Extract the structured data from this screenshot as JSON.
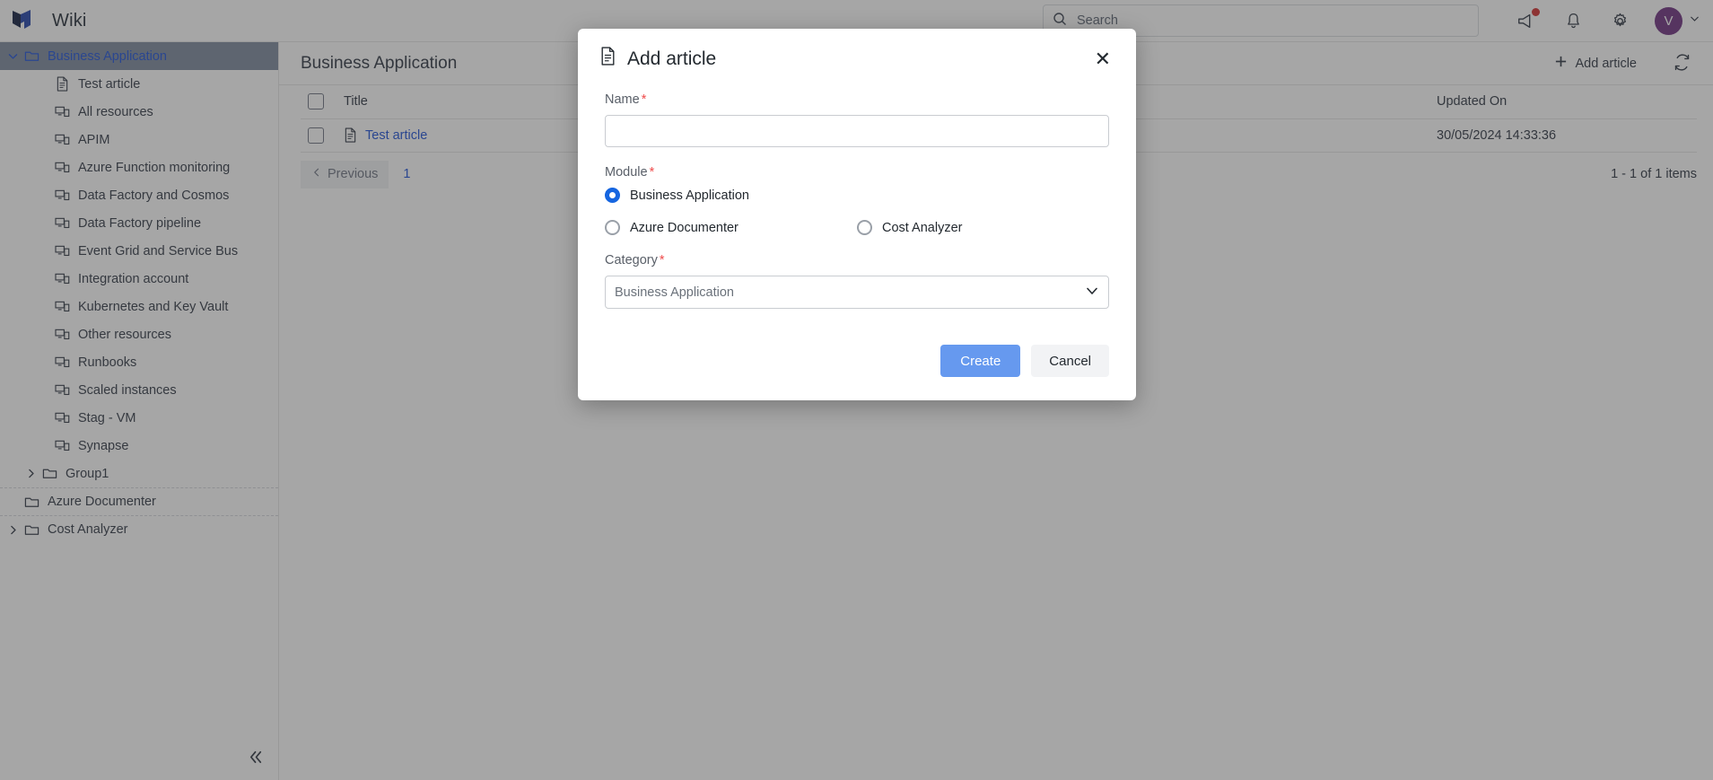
{
  "app": {
    "title": "Wiki",
    "logo_colors": {
      "dark": "#0d1b3e",
      "blue": "#1f3fa8"
    }
  },
  "header": {
    "search_placeholder": "Search",
    "search_value": "",
    "search_icon": "search-icon",
    "announcements_icon": "megaphone-icon",
    "announcements_badge_color": "#d12b2b",
    "notifications_icon": "bell-icon",
    "settings_icon": "gear-icon",
    "avatar_initial": "V",
    "avatar_color": "#6b2d7e",
    "avatar_caret_icon": "chevron-down-icon"
  },
  "sidebar": {
    "collapse_icon": "double-chevron-left-icon",
    "items": [
      {
        "label": "Business Application",
        "indent": 0,
        "icon": "folder-icon",
        "caret": "chevron-down",
        "selected": true,
        "link": true
      },
      {
        "label": "Test article",
        "indent": 2,
        "icon": "document-icon",
        "caret": "none",
        "selected": false,
        "link": false
      },
      {
        "label": "All resources",
        "indent": 2,
        "icon": "resource-icon",
        "caret": "none",
        "selected": false,
        "link": false
      },
      {
        "label": "APIM",
        "indent": 2,
        "icon": "resource-icon",
        "caret": "none",
        "selected": false,
        "link": false
      },
      {
        "label": "Azure Function monitoring",
        "indent": 2,
        "icon": "resource-icon",
        "caret": "none",
        "selected": false,
        "link": false
      },
      {
        "label": "Data Factory and Cosmos",
        "indent": 2,
        "icon": "resource-icon",
        "caret": "none",
        "selected": false,
        "link": false
      },
      {
        "label": "Data Factory pipeline",
        "indent": 2,
        "icon": "resource-icon",
        "caret": "none",
        "selected": false,
        "link": false
      },
      {
        "label": "Event Grid and Service Bus",
        "indent": 2,
        "icon": "resource-icon",
        "caret": "none",
        "selected": false,
        "link": false
      },
      {
        "label": "Integration account",
        "indent": 2,
        "icon": "resource-icon",
        "caret": "none",
        "selected": false,
        "link": false
      },
      {
        "label": "Kubernetes and Key Vault",
        "indent": 2,
        "icon": "resource-icon",
        "caret": "none",
        "selected": false,
        "link": false
      },
      {
        "label": "Other resources",
        "indent": 2,
        "icon": "resource-icon",
        "caret": "none",
        "selected": false,
        "link": false
      },
      {
        "label": "Runbooks",
        "indent": 2,
        "icon": "resource-icon",
        "caret": "none",
        "selected": false,
        "link": false
      },
      {
        "label": "Scaled instances",
        "indent": 2,
        "icon": "resource-icon",
        "caret": "none",
        "selected": false,
        "link": false
      },
      {
        "label": "Stag - VM",
        "indent": 2,
        "icon": "resource-icon",
        "caret": "none",
        "selected": false,
        "link": false
      },
      {
        "label": "Synapse",
        "indent": 2,
        "icon": "resource-icon",
        "caret": "none",
        "selected": false,
        "link": false
      },
      {
        "label": "Group1",
        "indent": 1,
        "icon": "folder-icon",
        "caret": "chevron-right",
        "selected": false,
        "link": false
      },
      {
        "label": "Azure Documenter",
        "indent": 0,
        "icon": "folder-icon",
        "caret": "none",
        "selected": false,
        "link": false,
        "divider_above": true
      },
      {
        "label": "Cost Analyzer",
        "indent": 0,
        "icon": "folder-icon",
        "caret": "chevron-right",
        "selected": false,
        "link": false,
        "divider_above": true
      }
    ]
  },
  "main": {
    "title": "Business Application",
    "add_article_label": "Add article",
    "add_icon": "plus-icon",
    "refresh_icon": "refresh-icon",
    "table": {
      "columns": [
        "",
        "Title",
        "Updated On"
      ],
      "rows": [
        {
          "title": "Test article",
          "updated_on": "30/05/2024 14:33:36",
          "icon": "document-icon"
        }
      ]
    },
    "pagination": {
      "previous_label": "Previous",
      "previous_icon": "chevron-left-icon",
      "page_number": "1",
      "count_label": "1 - 1 of 1 items"
    }
  },
  "modal": {
    "title": "Add article",
    "title_icon": "document-icon",
    "close_icon": "close-icon",
    "name": {
      "label": "Name",
      "required": "*",
      "value": "",
      "placeholder": ""
    },
    "module": {
      "label": "Module",
      "required": "*",
      "options": [
        {
          "label": "Business Application",
          "checked": true
        },
        {
          "label": "Azure Documenter",
          "checked": false
        },
        {
          "label": "Cost Analyzer",
          "checked": false
        }
      ]
    },
    "category": {
      "label": "Category",
      "required": "*",
      "selected": "Business Application",
      "caret_icon": "chevron-down-icon"
    },
    "create_label": "Create",
    "cancel_label": "Cancel",
    "primary_color": "#6699ef"
  }
}
